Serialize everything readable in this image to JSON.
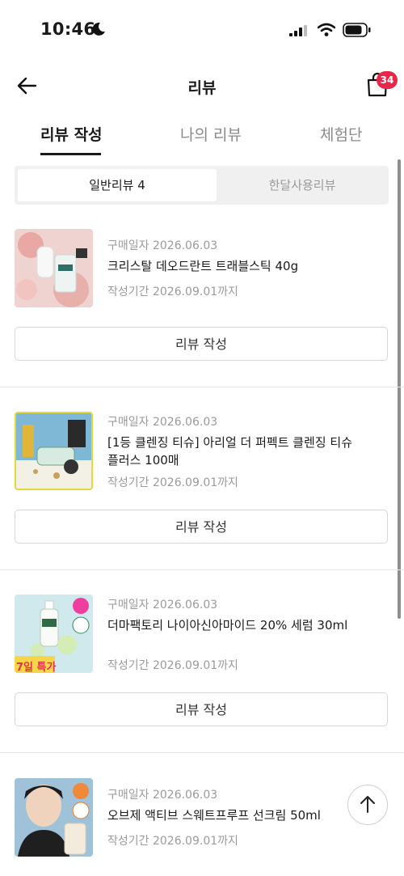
{
  "status_bar": {
    "time": "10:46"
  },
  "header": {
    "title": "리뷰",
    "cart_badge": "34"
  },
  "tabs": [
    {
      "label": "리뷰 작성"
    },
    {
      "label": "나의 리뷰"
    },
    {
      "label": "체험단"
    }
  ],
  "segment": {
    "general": "일반리뷰 4",
    "monthly": "한달사용리뷰"
  },
  "items": [
    {
      "date": "구매일자 2026.06.03",
      "title": "크리스탈 데오드란트 트래블스틱 40g",
      "period": "작성기간 2026.09.01까지",
      "button": "리뷰 작성"
    },
    {
      "date": "구매일자 2026.06.03",
      "title": "[1등 클렌징 티슈] 아리얼 더 퍼펙트 클렌징 티슈 플러스 100매",
      "period": "작성기간 2026.09.01까지",
      "button": "리뷰 작성"
    },
    {
      "date": "구매일자 2026.06.03",
      "title": "더마팩토리 나이아신아마이드 20% 세럼 30ml",
      "period": "작성기간 2026.09.01까지",
      "button": "리뷰 작성",
      "thumb_tag": "7일 특가"
    },
    {
      "date": "구매일자 2026.06.03",
      "title": "오브제 액티브 스웨트프루프 선크림 50ml",
      "period": "작성기간 2026.09.01까지"
    }
  ],
  "colors": {
    "badge": "#e8264a",
    "active_text": "#1a1a1a",
    "muted_text": "#9a9a9a"
  }
}
